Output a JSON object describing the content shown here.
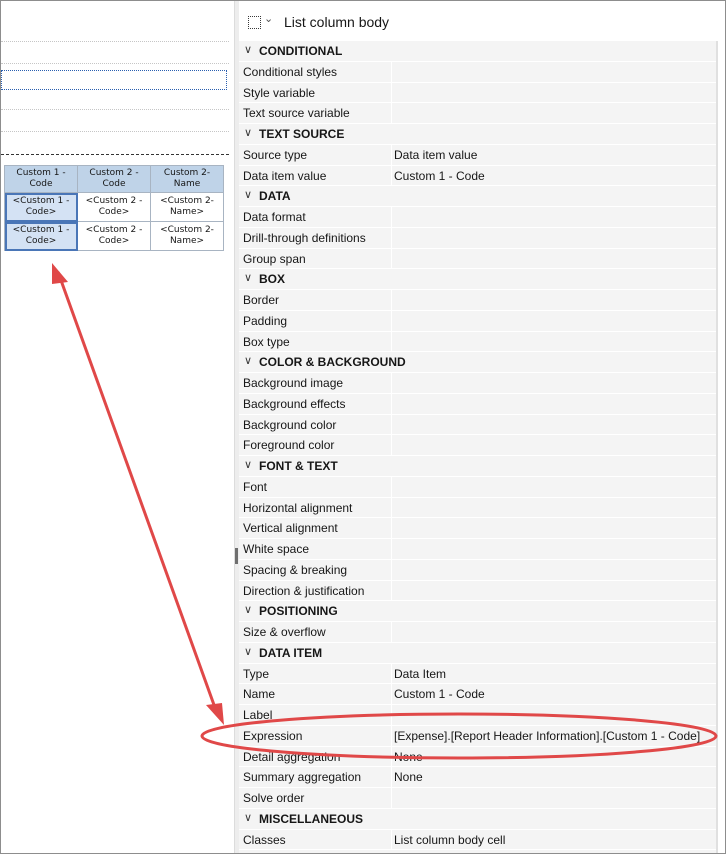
{
  "canvas": {
    "table": {
      "header": [
        "Custom 1 - Code",
        "Custom 2 - Code",
        "Custom 2- Name"
      ],
      "rows": [
        [
          "<Custom 1 - Code>",
          "<Custom 2 - Code>",
          "<Custom 2- Name>"
        ],
        [
          "<Custom 1 - Code>",
          "<Custom 2 - Code>",
          "<Custom 2- Name>"
        ]
      ]
    }
  },
  "panel": {
    "title": "List column body",
    "sections": [
      {
        "title": "CONDITIONAL",
        "props": [
          {
            "label": "Conditional styles",
            "value": ""
          },
          {
            "label": "Style variable",
            "value": ""
          },
          {
            "label": "Text source variable",
            "value": ""
          }
        ]
      },
      {
        "title": "TEXT SOURCE",
        "props": [
          {
            "label": "Source type",
            "value": "Data item value"
          },
          {
            "label": "Data item value",
            "value": "Custom 1 - Code"
          }
        ]
      },
      {
        "title": "DATA",
        "props": [
          {
            "label": "Data format",
            "value": ""
          },
          {
            "label": "Drill-through definitions",
            "value": ""
          },
          {
            "label": "Group span",
            "value": ""
          }
        ]
      },
      {
        "title": "BOX",
        "props": [
          {
            "label": "Border",
            "value": ""
          },
          {
            "label": "Padding",
            "value": ""
          },
          {
            "label": "Box type",
            "value": ""
          }
        ]
      },
      {
        "title": "COLOR & BACKGROUND",
        "props": [
          {
            "label": "Background image",
            "value": ""
          },
          {
            "label": "Background effects",
            "value": ""
          },
          {
            "label": "Background color",
            "value": ""
          },
          {
            "label": "Foreground color",
            "value": ""
          }
        ]
      },
      {
        "title": "FONT & TEXT",
        "props": [
          {
            "label": "Font",
            "value": ""
          },
          {
            "label": "Horizontal alignment",
            "value": ""
          },
          {
            "label": "Vertical alignment",
            "value": ""
          },
          {
            "label": "White space",
            "value": ""
          },
          {
            "label": "Spacing & breaking",
            "value": ""
          },
          {
            "label": "Direction & justification",
            "value": ""
          }
        ]
      },
      {
        "title": "POSITIONING",
        "props": [
          {
            "label": "Size & overflow",
            "value": ""
          }
        ]
      },
      {
        "title": "DATA ITEM",
        "props": [
          {
            "label": "Type",
            "value": "Data Item"
          },
          {
            "label": "Name",
            "value": " Custom 1 - Code"
          },
          {
            "label": "Label",
            "value": ""
          },
          {
            "label": "Expression",
            "value": "[Expense].[Report Header Information].[Custom 1 - Code]"
          },
          {
            "label": "Detail aggregation",
            "value": "None"
          },
          {
            "label": "Summary aggregation",
            "value": "None"
          },
          {
            "label": "Solve order",
            "value": ""
          }
        ]
      },
      {
        "title": "MISCELLANEOUS",
        "props": [
          {
            "label": "Classes",
            "value": "List column body cell"
          }
        ]
      }
    ]
  },
  "annotation": {
    "color": "#e04848"
  }
}
